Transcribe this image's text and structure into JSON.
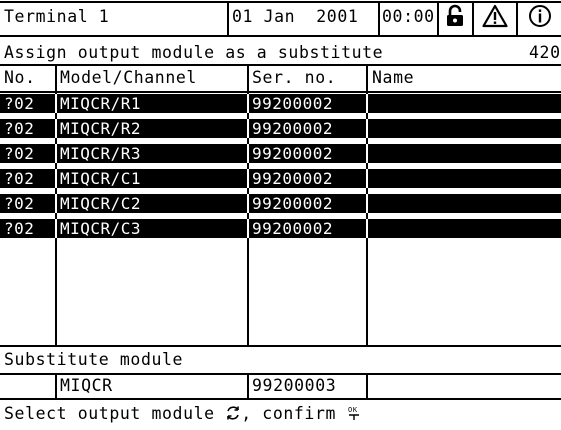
{
  "status_bar": {
    "terminal": "Terminal 1",
    "date": "01 Jan  2001",
    "time": "00:00",
    "icons": [
      "unlocked-padlock-icon",
      "warning-triangle-icon",
      "info-circle-icon"
    ]
  },
  "header": {
    "title": "Assign output module as a substitute",
    "code": "420"
  },
  "table": {
    "columns": [
      "No.",
      "Model/Channel",
      "Ser. no.",
      "Name"
    ],
    "rows": [
      {
        "no": "?02",
        "model": "MIQCR/R1",
        "serial": "99200002",
        "name": ""
      },
      {
        "no": "?02",
        "model": "MIQCR/R2",
        "serial": "99200002",
        "name": ""
      },
      {
        "no": "?02",
        "model": "MIQCR/R3",
        "serial": "99200002",
        "name": ""
      },
      {
        "no": "?02",
        "model": "MIQCR/C1",
        "serial": "99200002",
        "name": ""
      },
      {
        "no": "?02",
        "model": "MIQCR/C2",
        "serial": "99200002",
        "name": ""
      },
      {
        "no": "?02",
        "model": "MIQCR/C3",
        "serial": "99200002",
        "name": ""
      }
    ]
  },
  "substitute": {
    "label": "Substitute module",
    "model": "MIQCR",
    "serial": "99200003"
  },
  "footer": {
    "hint_part1": "Select output module ",
    "hint_part2": ", confirm ",
    "select_key_icon": "turn-knob-icon",
    "confirm_key_icon": "ok-key-icon"
  },
  "colors": {
    "background": "#ffffff",
    "foreground": "#000000"
  }
}
